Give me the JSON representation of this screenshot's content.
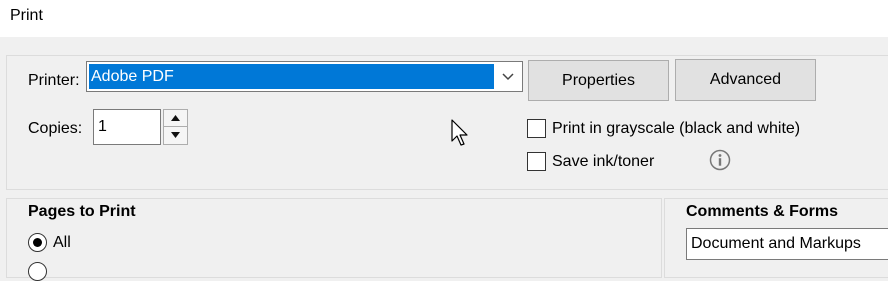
{
  "window": {
    "title": "Print"
  },
  "printer": {
    "label": "Printer:",
    "selected": "Adobe PDF"
  },
  "buttons": {
    "properties": "Properties",
    "advanced": "Advanced"
  },
  "copies": {
    "label": "Copies:",
    "value": "1"
  },
  "options": {
    "grayscale": {
      "label": "Print in grayscale (black and white)",
      "checked": false
    },
    "save_ink": {
      "label": "Save ink/toner",
      "checked": false
    }
  },
  "pages_to_print": {
    "heading": "Pages to Print",
    "all_label": "All",
    "all_selected": true
  },
  "comments_forms": {
    "heading": "Comments & Forms",
    "selected": "Document and Markups"
  },
  "icons": {
    "info": "info-icon",
    "dropdown": "chevron-down-icon",
    "cursor": "mouse-pointer-icon"
  }
}
